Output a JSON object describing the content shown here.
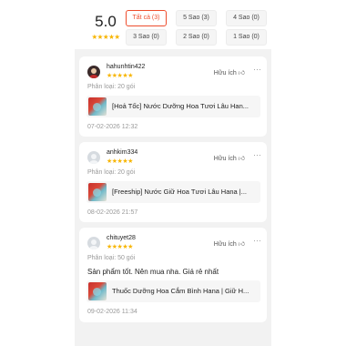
{
  "rating_summary": {
    "score": "5.0",
    "stars": "★★★★★",
    "filters": [
      {
        "label": "Tất cả (3)",
        "active": true
      },
      {
        "label": "5 Sao (3)",
        "active": false
      },
      {
        "label": "4 Sao (0)",
        "active": false
      },
      {
        "label": "3 Sao (0)",
        "active": false
      },
      {
        "label": "2 Sao (0)",
        "active": false
      },
      {
        "label": "1 Sao (0)",
        "active": false
      }
    ]
  },
  "helpful_label": "Hữu ích",
  "more_glyph": "···",
  "reviews": [
    {
      "username": "hahunhtin422",
      "stars": "★★★★★",
      "variant": "Phân loại: 20 gói",
      "comment": "",
      "product_title": "[Hoả Tốc] Nước Dưỡng Hoa Tươi Lâu Han...",
      "time": "07-02-2026 12:32"
    },
    {
      "username": "anhkim334",
      "stars": "★★★★★",
      "variant": "Phân loại: 20 gói",
      "comment": "",
      "product_title": "[Freeship] Nước Giữ Hoa Tươi Lâu Hana |...",
      "time": "08-02-2026 21:57"
    },
    {
      "username": "chituyet28",
      "stars": "★★★★★",
      "variant": "Phân loại: 50 gói",
      "comment": "Sản phẩm tốt. Nên mua nha. Giá rẻ nhất",
      "product_title": "Thuốc Dưỡng Hoa Cắm Bình Hana | Giữ H...",
      "time": "09-02-2026 11:34"
    }
  ]
}
